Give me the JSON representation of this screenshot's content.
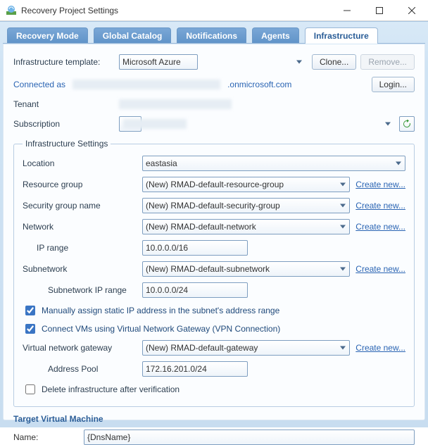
{
  "window": {
    "title": "Recovery Project Settings"
  },
  "tabs": {
    "recovery_mode": "Recovery Mode",
    "global_catalog": "Global Catalog",
    "notifications": "Notifications",
    "agents": "Agents",
    "infrastructure": "Infrastructure"
  },
  "template": {
    "label": "Infrastructure template:",
    "value": "Microsoft Azure",
    "clone": "Clone...",
    "remove": "Remove..."
  },
  "connection": {
    "label": "Connected as",
    "domain_suffix": ".onmicrosoft.com",
    "login": "Login..."
  },
  "tenant": {
    "label": "Tenant"
  },
  "subscription": {
    "label": "Subscription"
  },
  "settings": {
    "legend": "Infrastructure Settings",
    "location": {
      "label": "Location",
      "value": "eastasia"
    },
    "resource_group": {
      "label": "Resource group",
      "value": "(New) RMAD-default-resource-group",
      "create": "Create new..."
    },
    "security_group": {
      "label": "Security group name",
      "value": "(New) RMAD-default-security-group",
      "create": "Create new..."
    },
    "network": {
      "label": "Network",
      "value": "(New) RMAD-default-network",
      "create": "Create new..."
    },
    "ip_range": {
      "label": "IP range",
      "value": "10.0.0.0/16"
    },
    "subnetwork": {
      "label": "Subnetwork",
      "value": "(New) RMAD-default-subnetwork",
      "create": "Create new..."
    },
    "sub_ip_range": {
      "label": "Subnetwork IP range",
      "value": "10.0.0.0/24"
    },
    "chk_static": "Manually assign static IP address in the subnet's address range",
    "chk_vpn": "Connect VMs using Virtual Network Gateway (VPN Connection)",
    "vnet_gateway": {
      "label": "Virtual network gateway",
      "value": "(New) RMAD-default-gateway",
      "create": "Create new..."
    },
    "address_pool": {
      "label": "Address Pool",
      "value": "172.16.201.0/24"
    },
    "chk_delete": "Delete infrastructure after verification"
  },
  "target_vm": {
    "heading": "Target Virtual Machine",
    "name_label": "Name:",
    "name_value": "{DnsName}"
  }
}
